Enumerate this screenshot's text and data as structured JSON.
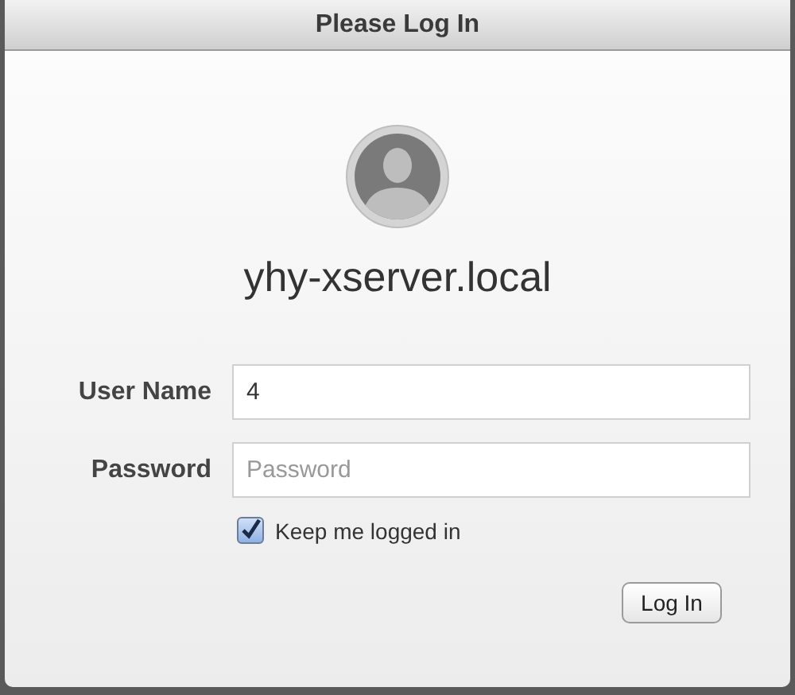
{
  "window": {
    "title": "Please Log In"
  },
  "host": "yhy-xserver.local",
  "fields": [
    {
      "label": "User Name",
      "value": "4"
    },
    {
      "label": "Password",
      "placeholder": "Password"
    }
  ],
  "keep_logged_in": {
    "label": "Keep me logged in",
    "checked": true
  },
  "button": "Log In"
}
